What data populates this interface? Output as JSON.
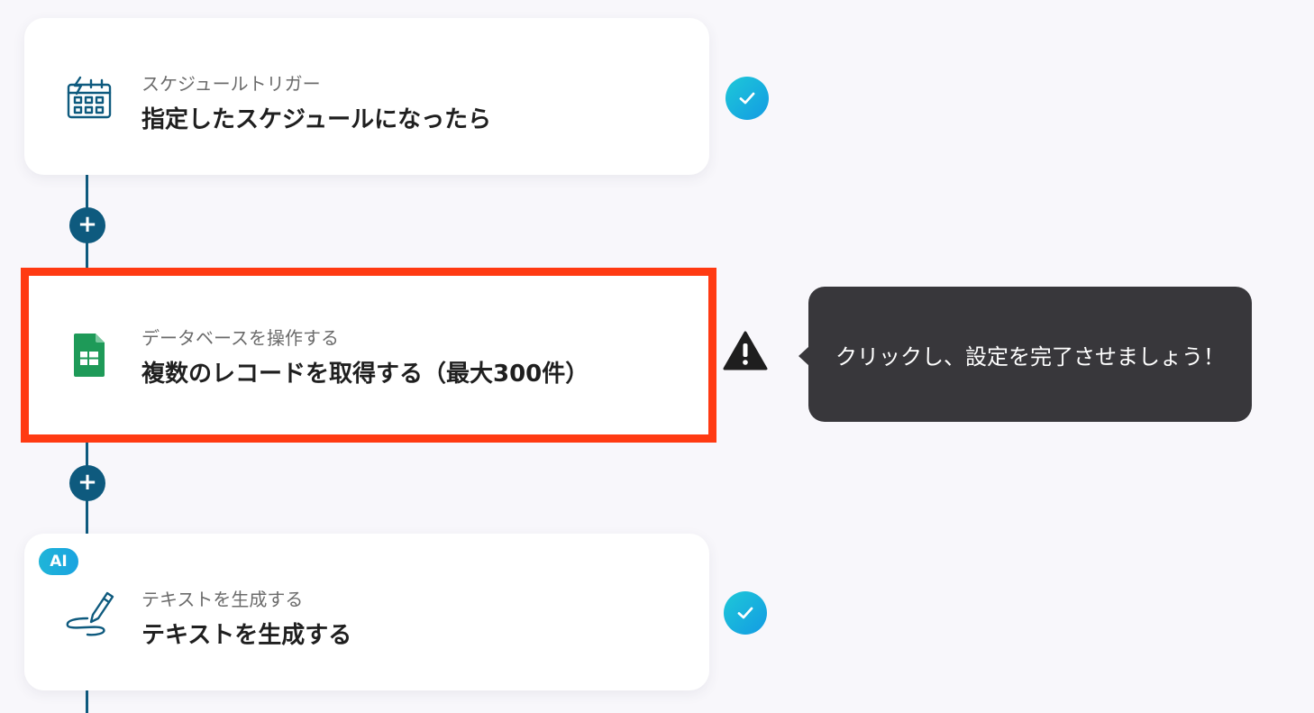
{
  "flow": {
    "steps": [
      {
        "subtitle": "スケジュールトリガー",
        "title": "指定したスケジュールになったら",
        "icon": "calendar-schedule-icon",
        "status": "completed"
      },
      {
        "subtitle": "データベースを操作する",
        "title": "複数のレコードを取得する（最大300件）",
        "icon": "google-sheets-icon",
        "status": "warning"
      },
      {
        "subtitle": "テキストを生成する",
        "title": "テキストを生成する",
        "icon": "pen-write-icon",
        "status": "completed",
        "badge": "AI"
      }
    ],
    "tooltip": "クリックし、設定を完了させましょう！"
  },
  "colors": {
    "connector": "#0e5a7e",
    "highlight_border": "#ff3a12",
    "check_gradient_start": "#1ec8d8",
    "check_gradient_end": "#139be3",
    "tooltip_bg": "#38373b",
    "sheets_green": "#1e9a58"
  }
}
